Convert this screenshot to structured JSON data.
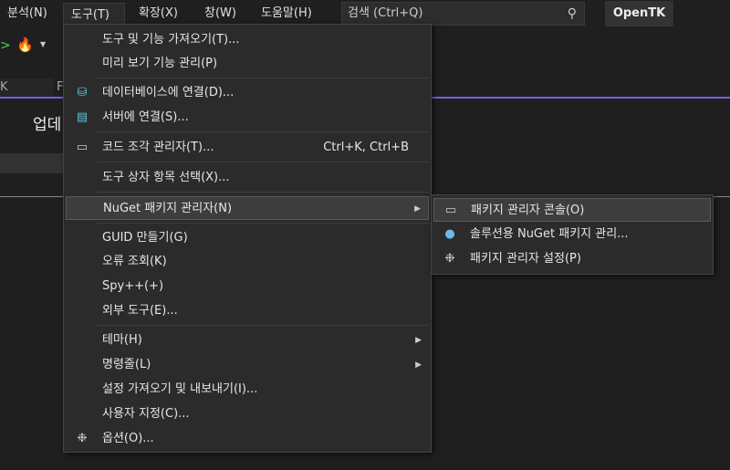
{
  "menubar": [
    "분석(N)",
    "도구(T)",
    "확장(X)",
    "창(W)",
    "도움말(H)"
  ],
  "search": {
    "placeholder": "검색 (Ctrl+Q)",
    "icon": "search-icon"
  },
  "project": "OpenTK",
  "background": {
    "tab_fragment_1": "K",
    "tab_fragment_2": "F",
    "heading_fragment": "업데"
  },
  "tools_menu": {
    "items": [
      {
        "label": "도구 및 기능 가져오기(T)..."
      },
      {
        "label": "미리 보기 기능 관리(P)"
      },
      {
        "label": "데이터베이스에 연결(D)...",
        "icon": "database-connect-icon"
      },
      {
        "label": "서버에 연결(S)...",
        "icon": "server-connect-icon"
      },
      {
        "label": "코드 조각 관리자(T)...",
        "shortcut": "Ctrl+K, Ctrl+B",
        "icon": "snippet-icon"
      },
      {
        "label": "도구 상자 항목 선택(X)..."
      },
      {
        "label": "NuGet 패키지 관리자(N)",
        "submenu": true
      },
      {
        "label": "GUID 만들기(G)"
      },
      {
        "label": "오류 조회(K)"
      },
      {
        "label": "Spy++(+)"
      },
      {
        "label": "외부 도구(E)..."
      },
      {
        "label": "테마(H)",
        "submenu": true
      },
      {
        "label": "명령줄(L)",
        "submenu": true
      },
      {
        "label": "설정 가져오기 및 내보내기(I)..."
      },
      {
        "label": "사용자 지정(C)..."
      },
      {
        "label": "옵션(O)...",
        "icon": "gear-icon"
      }
    ]
  },
  "nuget_submenu": {
    "items": [
      {
        "label": "패키지 관리자 콘솔(O)",
        "icon": "console-icon"
      },
      {
        "label": "솔루션용 NuGet 패키지 관리...",
        "icon": "nuget-icon"
      },
      {
        "label": "패키지 관리자 설정(P)",
        "icon": "gear-icon"
      }
    ]
  },
  "colors": {
    "accent": "#7160e8",
    "menu_bg": "#2b2b2b",
    "bg": "#1f1f1f"
  }
}
